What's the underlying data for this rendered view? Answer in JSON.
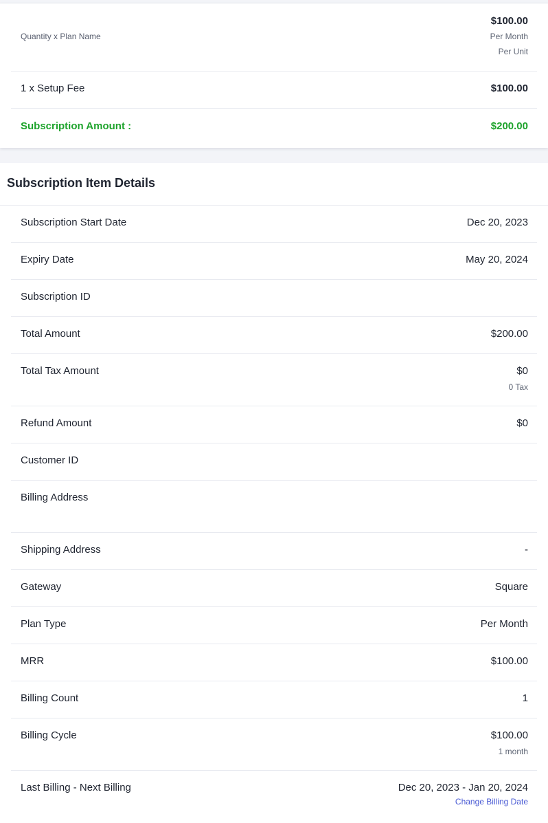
{
  "summary": {
    "plan_row": {
      "label": "Quantity x Plan Name",
      "price": "$100.00",
      "period": "Per Month",
      "unit": "Per Unit"
    },
    "setup_row": {
      "label": "1 x Setup Fee",
      "value": "$100.00"
    },
    "total_row": {
      "label": "Subscription Amount :",
      "value": "$200.00"
    }
  },
  "details": {
    "title": "Subscription Item Details",
    "rows": [
      {
        "label": "Subscription Start Date",
        "value": "Dec 20, 2023"
      },
      {
        "label": "Expiry Date",
        "value": "May 20, 2024"
      },
      {
        "label": "Subscription ID",
        "value": ""
      },
      {
        "label": "Total Amount",
        "value": "$200.00"
      },
      {
        "label": "Total Tax Amount",
        "value": "$0",
        "sub": "0 Tax"
      },
      {
        "label": "Refund Amount",
        "value": "$0"
      },
      {
        "label": "Customer ID",
        "value": ""
      },
      {
        "label": "Billing Address",
        "value": ""
      },
      {
        "label": "Shipping Address",
        "value": "-"
      },
      {
        "label": "Gateway",
        "value": "Square"
      },
      {
        "label": "Plan Type",
        "value": "Per Month"
      },
      {
        "label": "MRR",
        "value": "$100.00"
      },
      {
        "label": "Billing Count",
        "value": "1"
      },
      {
        "label": "Billing Cycle",
        "value": "$100.00",
        "sub": "1 month"
      },
      {
        "label": "Last Billing - Next Billing",
        "value": "Dec 20, 2023 - Jan 20, 2024",
        "link": "Change Billing Date"
      }
    ]
  },
  "colors": {
    "accent_green": "#1ea32c",
    "link_blue": "#4a5bd4"
  }
}
